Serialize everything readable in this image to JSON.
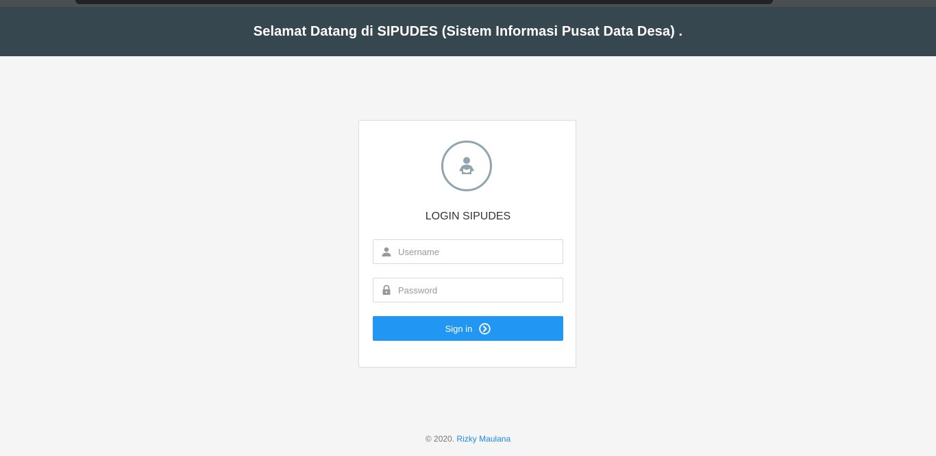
{
  "header": {
    "title": "Selamat Datang di SIPUDES (Sistem Informasi Pusat Data Desa) ."
  },
  "login": {
    "avatar_icon": "user-reading-icon",
    "title": "LOGIN SIPUDES",
    "username": {
      "placeholder": "Username",
      "value": "",
      "icon": "user-icon"
    },
    "password": {
      "placeholder": "Password",
      "value": "",
      "icon": "lock-icon"
    },
    "submit_label": "Sign in",
    "submit_icon": "circle-arrow-right-icon"
  },
  "footer": {
    "copyright": "© 2020.",
    "author": "Rizky Maulana"
  },
  "colors": {
    "header_bg": "#37474f",
    "page_bg": "#f5f5f5",
    "accent": "#2196f3",
    "icon_gray": "#90a4ae",
    "link": "#1e88e5"
  }
}
